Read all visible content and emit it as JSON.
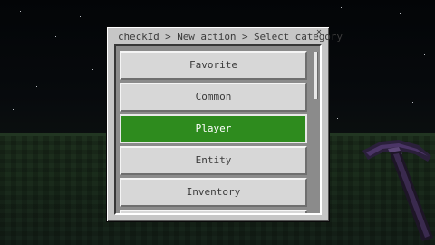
{
  "dialog": {
    "title": "checkId > New action > Select category",
    "close_icon": "close-icon",
    "categories": [
      {
        "label": "Favorite",
        "selected": false
      },
      {
        "label": "Common",
        "selected": false
      },
      {
        "label": "Player",
        "selected": true
      },
      {
        "label": "Entity",
        "selected": false
      },
      {
        "label": "Inventory",
        "selected": false
      }
    ]
  },
  "colors": {
    "selected": "#2e8b1e",
    "button": "#d7d7d7",
    "dialog": "#c6c6c6",
    "ground": "#1d2f1d"
  },
  "scene": {
    "held_item_icon": "netherite-pickaxe-icon"
  }
}
